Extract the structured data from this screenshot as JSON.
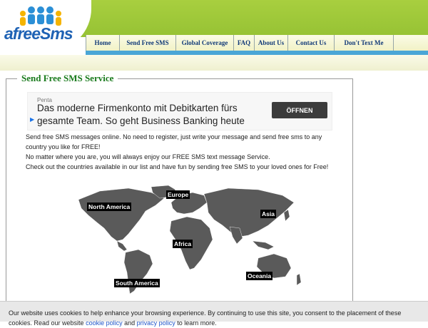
{
  "logo": {
    "text": "afreeSms"
  },
  "nav": {
    "items": [
      {
        "label": "Home",
        "w": 46
      },
      {
        "label": "Send Free SMS",
        "w": 78
      },
      {
        "label": "Global Coverage",
        "w": 80
      },
      {
        "label": "FAQ",
        "w": 28
      },
      {
        "label": "About Us",
        "w": 46
      },
      {
        "label": "Contact Us",
        "w": 64
      },
      {
        "label": "Don't Text Me",
        "w": 82
      }
    ]
  },
  "section": {
    "title": "Send Free SMS Service"
  },
  "ad": {
    "brand": "Penta",
    "headline": "Das moderne Firmenkonto mit Debitkarten fürs gesamte Team. So geht Business Banking heute",
    "button": "ÖFFNEN"
  },
  "intro": {
    "lines": [
      "Send free SMS messages online. No need to register, just write your message and send free sms to any country you like for FREE!",
      "No matter where you are, you will always enjoy our FREE SMS text message Service.",
      "Check out the countries available in our list and have fun by sending free SMS to your loved ones for Free!"
    ]
  },
  "map": {
    "labels": {
      "europe": "Europe",
      "north_america": "North America",
      "asia": "Asia",
      "africa": "Africa",
      "oceania": "Oceania",
      "south_america": "South America"
    }
  },
  "cookie": {
    "text_before": "Our website uses cookies to help enhance your browsing experience. By continuing to use this site, you consent to the placement of these cookies. Read our website",
    "cookie_link": "cookie policy",
    "and": "and",
    "privacy_link": "privacy policy",
    "text_after": "to learn more."
  },
  "colors": {
    "header_green": "#a8cf3f",
    "nav_text": "#123a77",
    "title_green": "#197a1c",
    "link_blue": "#1f55c9"
  }
}
